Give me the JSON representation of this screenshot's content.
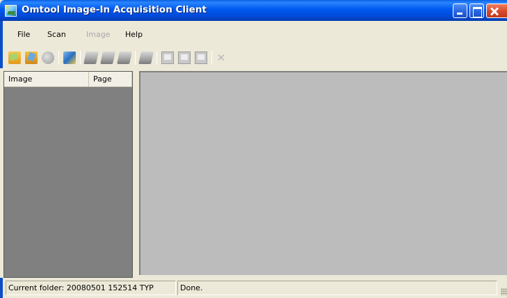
{
  "window": {
    "title": "Omtool Image-In Acquisition Client"
  },
  "menu": {
    "items": [
      {
        "label": "File",
        "enabled": true
      },
      {
        "label": "Scan",
        "enabled": true
      },
      {
        "label": "Image",
        "enabled": false
      },
      {
        "label": "Help",
        "enabled": true
      }
    ]
  },
  "toolbar": {
    "buttons": [
      {
        "icon": "open-folder-icon",
        "enabled": true
      },
      {
        "icon": "import-folder-icon",
        "enabled": true
      },
      {
        "icon": "preview-icon",
        "enabled": false
      },
      {
        "icon": "properties-icon",
        "enabled": true
      },
      {
        "icon": "scan-icon",
        "enabled": false
      },
      {
        "icon": "scan-page-icon",
        "enabled": false
      },
      {
        "icon": "scan-batch-icon",
        "enabled": false
      },
      {
        "icon": "rescan-icon",
        "enabled": false
      },
      {
        "icon": "insert-page-icon",
        "enabled": false
      },
      {
        "icon": "append-page-icon",
        "enabled": false
      },
      {
        "icon": "replace-page-icon",
        "enabled": false
      },
      {
        "icon": "delete-icon",
        "enabled": false
      }
    ]
  },
  "image_list": {
    "columns": [
      "Image",
      "Page"
    ],
    "rows": []
  },
  "statusbar": {
    "folder_text": "Current folder: 20080501 152514 TYP",
    "message": "Done."
  },
  "colors": {
    "titlebar": "#0058ee",
    "panel_bg": "#808080",
    "view_bg": "#bcbcbc",
    "chrome": "#ece9d8"
  }
}
